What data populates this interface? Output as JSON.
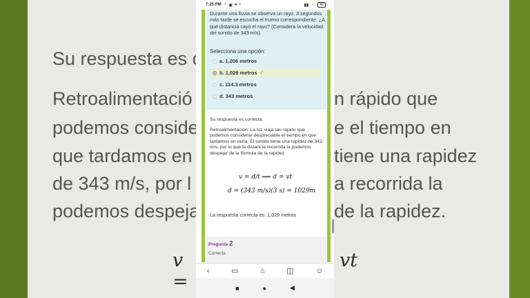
{
  "status_bar": {
    "time": "7:25 PM",
    "battery": "46"
  },
  "question": {
    "text": "Durante una lluvia se observa un rayo, 3 segundos más tarde se escucha el trueno correspondiente. ¿A qué distancia cayó el rayo? (Considera la velocidad del sonido de 343 m/s).",
    "select_label": "Selecciona una opción:",
    "options": [
      {
        "label": "a. 1,206 metros"
      },
      {
        "label": "b. 1,029 metros"
      },
      {
        "label": "c. 114.3 metros"
      },
      {
        "label": "d. 343 metros"
      }
    ]
  },
  "feedback": {
    "result": "Su respuesta es correcta.",
    "retro": "Retroalimentación:  La luz viaja tan rápido que podemos considerar despreciable el tiempo en que tardamos en verla. El sonido tiene una rapidez de 343 m/s, por lo que la distancia recorrida la podemos despejar de la fórmula de la rapidez.",
    "formula1": "v = d/t ⟹ d = vt",
    "formula2": "d = (343 m/s)(3 s) = 1029m",
    "correct_answer": "La respuesta correcta es: 1,029 metros"
  },
  "pregunta": {
    "label": "Pregunta",
    "number": "2",
    "state": "Correcta"
  },
  "background": {
    "line1": "Su respuesta es c",
    "line2": "Retroalimentació",
    "line2b": "n rápido que",
    "line3": "podemos conside",
    "line3b": "e el tiempo en",
    "line4": "que tardamos en",
    "line4b": "tiene una rapidez",
    "line5": "de 343 m/s, por l",
    "line5b": "a recorrida la",
    "line6": "podemos despeja",
    "line6b": "de la rapidez.",
    "formula_left": "v =",
    "formula_right": "vt"
  },
  "colors": {
    "accent_green": "#9ac53b",
    "question_bg": "#dff0f5",
    "pregunta_purple": "#8a3b8f"
  }
}
